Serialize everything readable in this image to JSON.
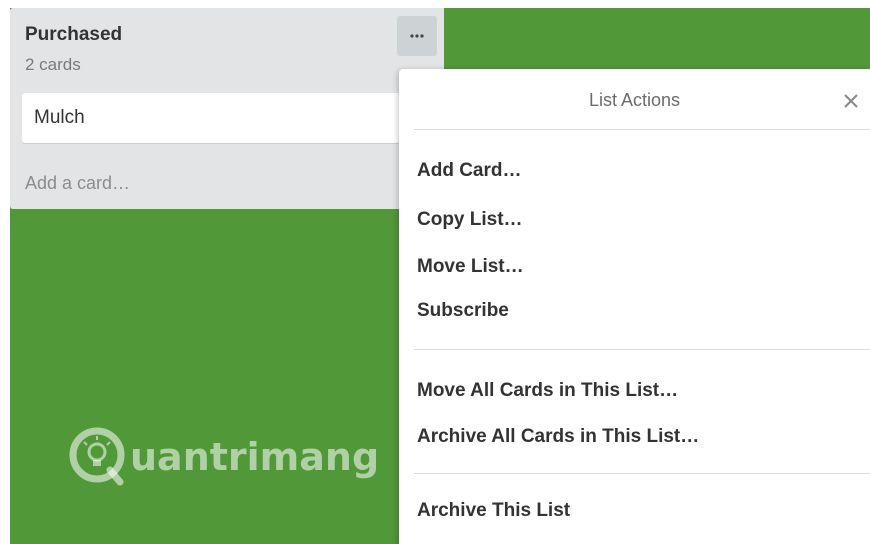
{
  "board": {
    "background_color": "#519839"
  },
  "list": {
    "title": "Purchased",
    "card_count": "2 cards",
    "menu_button_label": "···",
    "cards": [
      {
        "title": "Mulch"
      }
    ],
    "add_card_label": "Add a card…"
  },
  "popover": {
    "title": "List Actions",
    "close_icon": "close-icon",
    "sections": [
      {
        "items": [
          {
            "label": "Add Card…"
          },
          {
            "label": "Copy List…"
          },
          {
            "label": "Move List…"
          },
          {
            "label": "Subscribe"
          }
        ]
      },
      {
        "items": [
          {
            "label": "Move All Cards in This List…"
          },
          {
            "label": "Archive All Cards in This List…"
          }
        ]
      },
      {
        "items": [
          {
            "label": "Archive This List"
          }
        ]
      }
    ]
  },
  "watermark": {
    "text": "uantrimang",
    "logo_icon": "lightbulb-q-logo-icon"
  }
}
